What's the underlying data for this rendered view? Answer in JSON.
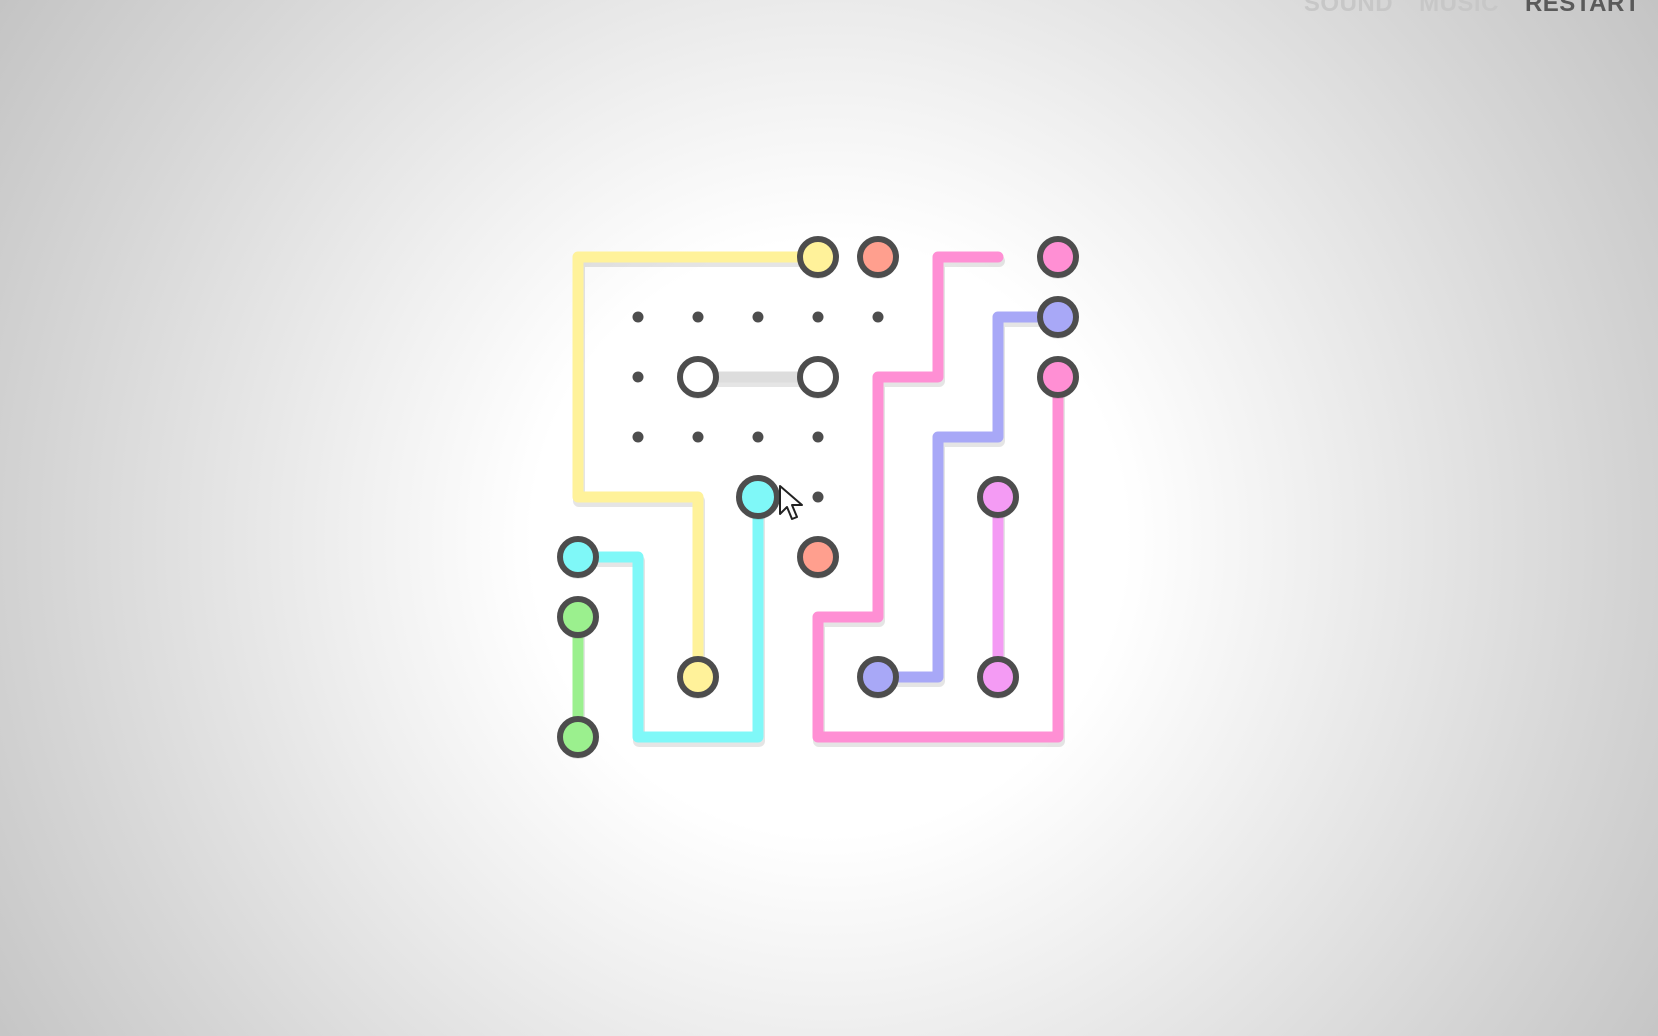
{
  "menu": {
    "sound_label": "SOUND",
    "music_label": "MUSIC",
    "restart_label": "RESTART"
  },
  "colors": {
    "yellow": "#fff29a",
    "salmon": "#ff9f8e",
    "pink": "#ff8fd4",
    "blue": "#a8a8f7",
    "cyan": "#7ff8f8",
    "green": "#9bf08e",
    "magenta": "#f49bf4",
    "empty": "#ffffff",
    "outline": "#4d4d4d",
    "dot": "#4d4d4d",
    "ghost": "#dddddd"
  },
  "board": {
    "cols": 9,
    "rows": 9,
    "cell": 60,
    "dots": [
      [
        2,
        2
      ],
      [
        3,
        2
      ],
      [
        4,
        2
      ],
      [
        5,
        2
      ],
      [
        6,
        2
      ],
      [
        2,
        3
      ],
      [
        2,
        4
      ],
      [
        3,
        4
      ],
      [
        4,
        4
      ],
      [
        5,
        4
      ],
      [
        5,
        5
      ]
    ],
    "paths": [
      {
        "color": "yellow",
        "points": [
          [
            5,
            1
          ],
          [
            1,
            1
          ],
          [
            1,
            5
          ],
          [
            3,
            5
          ],
          [
            3,
            8
          ]
        ]
      },
      {
        "color": "cyan",
        "points": [
          [
            1,
            6
          ],
          [
            2,
            6
          ],
          [
            2,
            9
          ],
          [
            4,
            9
          ],
          [
            4,
            5
          ]
        ]
      },
      {
        "color": "green",
        "points": [
          [
            1,
            7
          ],
          [
            1,
            9
          ]
        ]
      },
      {
        "color": "pink",
        "points": [
          [
            8,
            1
          ],
          [
            7,
            1
          ],
          [
            7,
            3
          ],
          [
            6,
            3
          ],
          [
            6,
            7
          ],
          [
            5,
            7
          ],
          [
            5,
            9
          ],
          [
            9,
            9
          ],
          [
            9,
            3
          ]
        ]
      },
      {
        "color": "blue",
        "points": [
          [
            9,
            2
          ],
          [
            8,
            2
          ],
          [
            8,
            4
          ],
          [
            7,
            4
          ],
          [
            7,
            8
          ],
          [
            6,
            8
          ]
        ]
      },
      {
        "color": "magenta",
        "points": [
          [
            8,
            5
          ],
          [
            8,
            8
          ]
        ]
      },
      {
        "color": "ghost",
        "points": [
          [
            3,
            3
          ],
          [
            5,
            3
          ]
        ]
      }
    ],
    "nodes": [
      {
        "col": 5,
        "row": 1,
        "color": "yellow"
      },
      {
        "col": 3,
        "row": 8,
        "color": "yellow"
      },
      {
        "col": 6,
        "row": 1,
        "color": "salmon"
      },
      {
        "col": 5,
        "row": 6,
        "color": "salmon"
      },
      {
        "col": 9,
        "row": 1,
        "color": "pink"
      },
      {
        "col": 9,
        "row": 3,
        "color": "pink"
      },
      {
        "col": 9,
        "row": 2,
        "color": "blue"
      },
      {
        "col": 6,
        "row": 8,
        "color": "blue"
      },
      {
        "col": 4,
        "row": 5,
        "color": "cyan",
        "active": true
      },
      {
        "col": 1,
        "row": 6,
        "color": "cyan"
      },
      {
        "col": 1,
        "row": 7,
        "color": "green"
      },
      {
        "col": 1,
        "row": 9,
        "color": "green"
      },
      {
        "col": 8,
        "row": 5,
        "color": "magenta"
      },
      {
        "col": 8,
        "row": 8,
        "color": "magenta"
      },
      {
        "col": 3,
        "row": 3,
        "color": "empty"
      },
      {
        "col": 5,
        "row": 3,
        "color": "empty"
      }
    ]
  }
}
